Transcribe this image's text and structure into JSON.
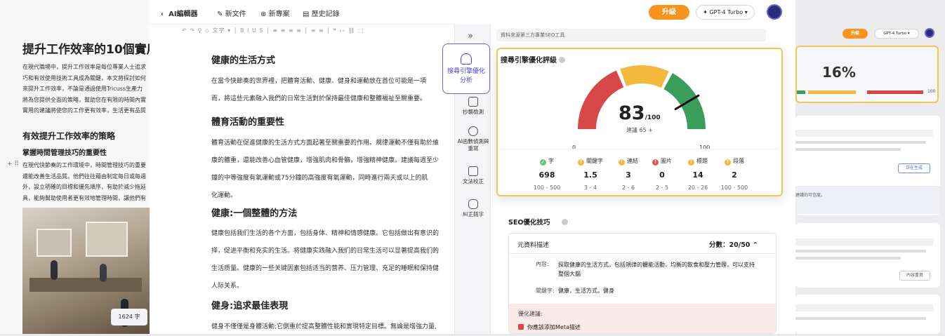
{
  "topbar": {
    "back_label": "AI編輯器",
    "new_doc": "新文件",
    "new_project": "新專案",
    "history": "歷史記錄",
    "upgrade": "升級",
    "model": "GPT-4 Turbo"
  },
  "left_bg": {
    "title": "提升工作效率的10個實用",
    "intro": [
      "在現代職場中，提升工作效率是每位專業人士追求",
      "巧和有效使用技術工具成為關鍵，本文將探討如何",
      "來提升工作效率，不論是通過使用Tricuss生產力",
      "將為您提供全面的策略，幫助您在有限的時間內實",
      "實用的建議將使您的工作更有效率，生活更有品質"
    ],
    "h2": "有效提升工作效率的策略",
    "h3": "掌握時間管理技巧的重要性",
    "para": [
      "在現代快節奏的工作環境中，時間管理技巧的重要",
      "還能改善生活品質。他們往往藉由制定每日或每週",
      "外，設立明確的目標和優先順序，有助於減少拖延",
      "具，能夠幫助使用者更有效地管理時間，讓他們有"
    ],
    "word_count": "1624 字"
  },
  "editor": {
    "sections": [
      {
        "heading": "健康的生活方式",
        "lines": [
          "在當今快節奏的世界裡，把體育活動、健康、健身和運動放在首位可能是一項",
          "而，將這些元素融入我們的日常生活對於保持最佳健康和整體福祉至關重要。"
        ]
      },
      {
        "heading": "體育活動的重要性",
        "lines": [
          "體育活動在促進健康的生活方式方面起著至關重要的作用。規律運動不僅有助於維",
          "康的體重，還能改善心血管健康，增強肌肉和骨骼，增強精神健康。建議每週至少",
          "鐘的中等強度有氧運動或75分鐘的高強度有氧運動，同時進行兩天或以上的肌",
          "化運動。"
        ]
      },
      {
        "heading": "健康:一個整體的方法",
        "lines": [
          "健康包括我们生活的各个方面，包括身体、精神和情感健康。它包括做出有意识的",
          "择，促进平衡和充实的生活。将健康实践融入我们的日常生活可以显著提高我们的",
          "生活质量。健康的一些关键因素包括适当的营养、压力管理、充足的睡眠和保持健",
          "人际关系。"
        ]
      },
      {
        "heading": "健身:追求最佳表現",
        "lines": [
          "健身不僅僅是身體活動;它側重於提高整體性能和實現特定目標。無論是增強力量,"
        ]
      }
    ]
  },
  "rail": {
    "collapse": "»",
    "items": [
      "搜尋引擎優化分析",
      "抄襲檢測",
      "AI函數偵測與重寫",
      "文法校正",
      "糾正錯字"
    ]
  },
  "panel": {
    "source": "資料來源第三方專業SEO工具",
    "seo_title": "搜尋引擎優化評級",
    "score": "83",
    "score_max": "/100",
    "suggest": "建議 65 +",
    "gauge_min": "0",
    "gauge_max": "100",
    "gauge_value": 83,
    "metrics": [
      {
        "label": "字",
        "value": "698",
        "range": "100 - 500",
        "status": "ok"
      },
      {
        "label": "關鍵字",
        "value": "1.5",
        "range": "3 - 4",
        "status": "up"
      },
      {
        "label": "連結",
        "value": "3",
        "range": "2 - 6",
        "status": "up"
      },
      {
        "label": "圖片",
        "value": "0",
        "range": "2 - 5",
        "status": "bad"
      },
      {
        "label": "標題",
        "value": "14",
        "range": "20 - 26",
        "status": "up"
      },
      {
        "label": "段落",
        "value": "2",
        "range": "100 - 500",
        "status": "up"
      }
    ],
    "tips_title": "SEO優化技巧",
    "meta_title": "元資料描述",
    "meta_score": "分數：20/50",
    "content_label": "內容:",
    "content_value": [
      "探取健康的生活方式，包括規律的體能活動，均衡的飲食和壓力管理，可以支持",
      "整個大腦"
    ],
    "keyword_label": "關鍵字:",
    "keyword_value": "健康，生活方式，健身",
    "suggestion_title": "優化建議:",
    "suggestion_item": "你應該添加Meta描述"
  },
  "right_bg": {
    "upgrade": "升級",
    "model": "GPT-4 Turbo",
    "percent": "16%",
    "bar_end": "100",
    "generating": "正在生成",
    "more": "內容重寫",
    "line1": "建議的可信度。"
  },
  "colors": {
    "red": "#d94848",
    "yellow": "#f3b93e",
    "green": "#3a9e5a",
    "accent": "#5b5bd6",
    "orange": "#f7941d"
  }
}
